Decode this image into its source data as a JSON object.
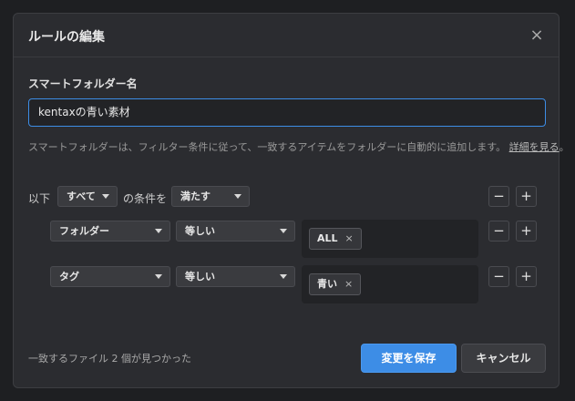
{
  "dialog": {
    "title": "ルールの編集",
    "close_icon": "×"
  },
  "name_section": {
    "label": "スマートフォルダー名",
    "value": "kentaxの青い素材"
  },
  "description": {
    "text": "スマートフォルダーは、フィルター条件に従って、一致するアイテムをフォルダーに自動的に追加します。",
    "link": "詳細を見る",
    "suffix": "。"
  },
  "rule_group": {
    "prefix": "以下",
    "match_select": "すべて",
    "middle": "の条件を",
    "condition_select": "満たす",
    "minus": "−",
    "plus": "+"
  },
  "rules": [
    {
      "field": "フォルダー",
      "operator": "等しい",
      "chip": "ALL",
      "chip_remove": "×",
      "minus": "−",
      "plus": "+"
    },
    {
      "field": "タグ",
      "operator": "等しい",
      "chip": "青い",
      "chip_remove": "×",
      "minus": "−",
      "plus": "+"
    }
  ],
  "footer": {
    "note": "一致するファイル 2 個が見つかった",
    "save_label": "変更を保存",
    "cancel_label": "キャンセル"
  },
  "colors": {
    "accent": "#3d8de6",
    "background": "#2b2c30"
  }
}
